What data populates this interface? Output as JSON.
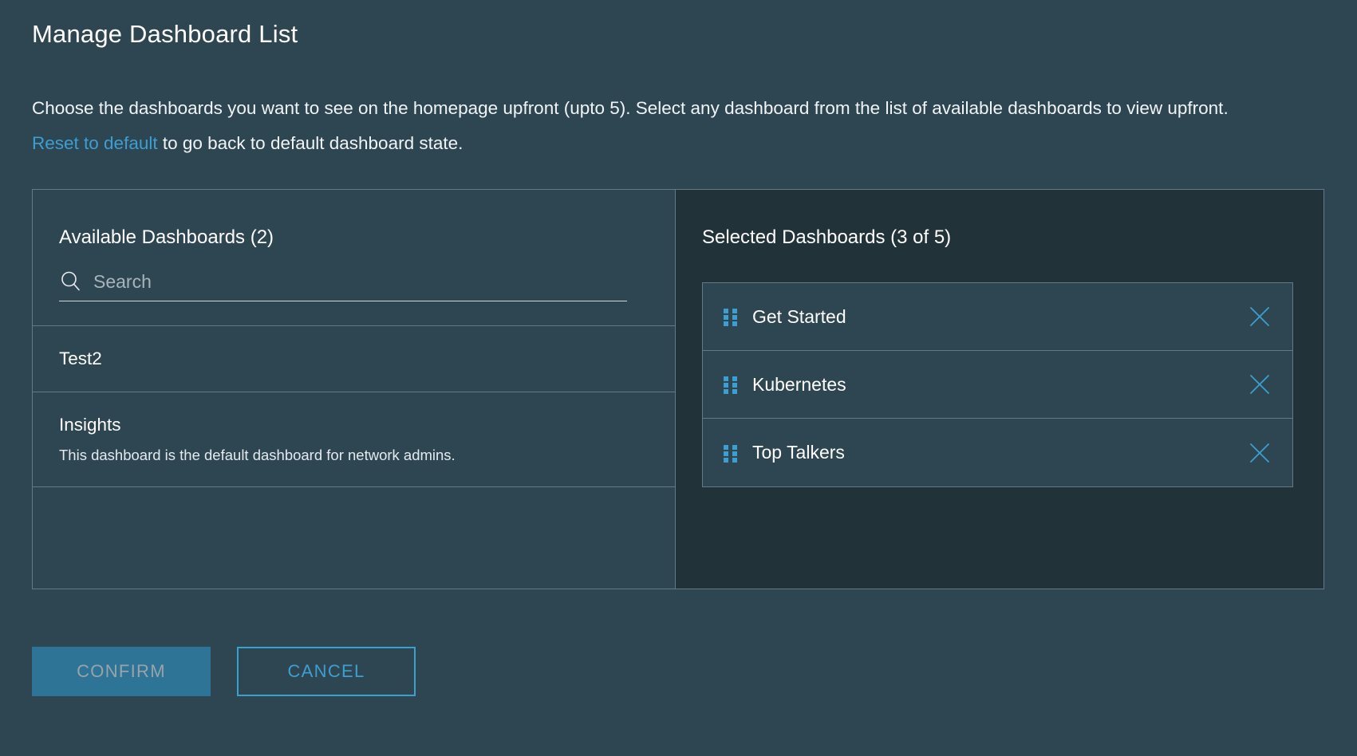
{
  "title": "Manage Dashboard List",
  "description": {
    "before_link": "Choose the dashboards you want to see on the homepage upfront (upto 5). Select any dashboard from the list of available dashboards to view upfront. ",
    "link_label": "Reset to default",
    "after_link": " to go back to default dashboard state."
  },
  "available_panel": {
    "heading": "Available Dashboards (2)",
    "search": {
      "placeholder": "Search",
      "value": "",
      "icon": "search-icon"
    },
    "items": [
      {
        "name": "Test2",
        "description": ""
      },
      {
        "name": "Insights",
        "description": "This dashboard is the default dashboard for network admins."
      }
    ]
  },
  "selected_panel": {
    "heading": "Selected Dashboards (3 of 5)",
    "items": [
      {
        "name": "Get Started",
        "drag_icon": "drag-handle-icon",
        "remove_icon": "close-icon"
      },
      {
        "name": "Kubernetes",
        "drag_icon": "drag-handle-icon",
        "remove_icon": "close-icon"
      },
      {
        "name": "Top Talkers",
        "drag_icon": "drag-handle-icon",
        "remove_icon": "close-icon"
      }
    ]
  },
  "footer": {
    "confirm_label": "CONFIRM",
    "cancel_label": "CANCEL"
  },
  "colors": {
    "page_background": "#2e4552",
    "panel_right_background": "#223239",
    "border": "#62798a",
    "accent_blue": "#3d9fd0",
    "confirm_fill": "#2d7496",
    "confirm_text_disabled": "#9aa3a8"
  }
}
